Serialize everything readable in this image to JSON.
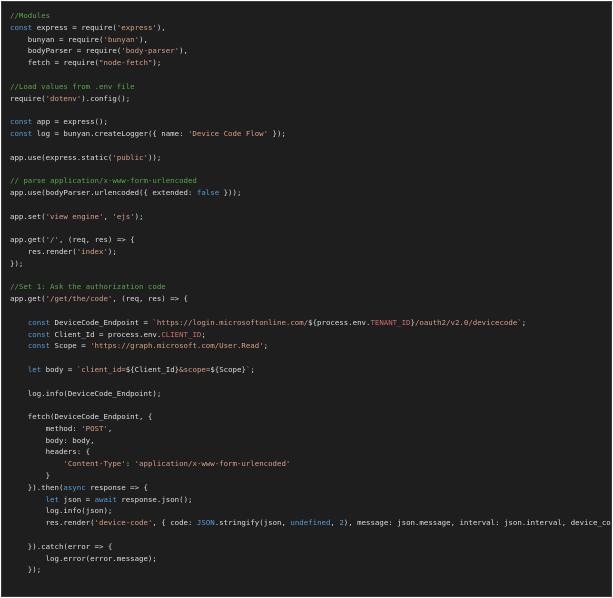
{
  "editor": {
    "lines": [
      [
        {
          "t": "//Modules",
          "k": "comment"
        }
      ],
      [
        {
          "t": "const",
          "k": "keyword"
        },
        {
          "t": " express = require(",
          "k": "plain"
        },
        {
          "t": "'express'",
          "k": "string"
        },
        {
          "t": "),",
          "k": "plain"
        }
      ],
      [
        {
          "t": "    bunyan = require(",
          "k": "plain"
        },
        {
          "t": "'bunyan'",
          "k": "string"
        },
        {
          "t": "),",
          "k": "plain"
        }
      ],
      [
        {
          "t": "    bodyParser = require(",
          "k": "plain"
        },
        {
          "t": "'body-parser'",
          "k": "string"
        },
        {
          "t": "),",
          "k": "plain"
        }
      ],
      [
        {
          "t": "    fetch = require(",
          "k": "plain"
        },
        {
          "t": "\"node-fetch\"",
          "k": "string"
        },
        {
          "t": ");",
          "k": "plain"
        }
      ],
      [],
      [
        {
          "t": "//Load values from .env file",
          "k": "comment"
        }
      ],
      [
        {
          "t": "require(",
          "k": "plain"
        },
        {
          "t": "'dotenv'",
          "k": "string"
        },
        {
          "t": ").config();",
          "k": "plain"
        }
      ],
      [],
      [
        {
          "t": "const",
          "k": "keyword"
        },
        {
          "t": " app = express();",
          "k": "plain"
        }
      ],
      [
        {
          "t": "const",
          "k": "keyword"
        },
        {
          "t": " log = bunyan.createLogger({ name: ",
          "k": "plain"
        },
        {
          "t": "'Device Code Flow'",
          "k": "string"
        },
        {
          "t": " });",
          "k": "plain"
        }
      ],
      [],
      [
        {
          "t": "app.use(express.static(",
          "k": "plain"
        },
        {
          "t": "'public'",
          "k": "string"
        },
        {
          "t": "));",
          "k": "plain"
        }
      ],
      [],
      [
        {
          "t": "// parse application/x-www-form-urlencoded",
          "k": "comment"
        }
      ],
      [
        {
          "t": "app.use(bodyParser.urlencoded({ extended: ",
          "k": "plain"
        },
        {
          "t": "false",
          "k": "keyword"
        },
        {
          "t": " }));",
          "k": "plain"
        }
      ],
      [],
      [
        {
          "t": "app.set(",
          "k": "plain"
        },
        {
          "t": "'view engine'",
          "k": "string"
        },
        {
          "t": ", ",
          "k": "plain"
        },
        {
          "t": "'ejs'",
          "k": "string"
        },
        {
          "t": ");",
          "k": "plain"
        }
      ],
      [],
      [
        {
          "t": "app.get(",
          "k": "plain"
        },
        {
          "t": "'/'",
          "k": "string"
        },
        {
          "t": ", (req, res) => {",
          "k": "plain"
        }
      ],
      [
        {
          "t": "    res.render(",
          "k": "plain"
        },
        {
          "t": "'index'",
          "k": "string"
        },
        {
          "t": ");",
          "k": "plain"
        }
      ],
      [
        {
          "t": "});",
          "k": "plain"
        }
      ],
      [],
      [
        {
          "t": "//Set 1: Ask the authorization code",
          "k": "comment"
        }
      ],
      [
        {
          "t": "app.get(",
          "k": "plain"
        },
        {
          "t": "'/get/the/code'",
          "k": "string"
        },
        {
          "t": ", (req, res) => {",
          "k": "plain"
        }
      ],
      [],
      [
        {
          "t": "    ",
          "k": "plain"
        },
        {
          "t": "const",
          "k": "keyword"
        },
        {
          "t": " DeviceCode_Endpoint = ",
          "k": "plain"
        },
        {
          "t": "`https://login.microsoftonline.com/",
          "k": "string"
        },
        {
          "t": "${process.env.",
          "k": "plain"
        },
        {
          "t": "TENANT_ID",
          "k": "special"
        },
        {
          "t": "}",
          "k": "plain"
        },
        {
          "t": "/oauth2/v2.0/devicecode`",
          "k": "string"
        },
        {
          "t": ";",
          "k": "plain"
        }
      ],
      [
        {
          "t": "    ",
          "k": "plain"
        },
        {
          "t": "const",
          "k": "keyword"
        },
        {
          "t": " Client_Id = process.env.",
          "k": "plain"
        },
        {
          "t": "CLIENT_ID",
          "k": "special"
        },
        {
          "t": ";",
          "k": "plain"
        }
      ],
      [
        {
          "t": "    ",
          "k": "plain"
        },
        {
          "t": "const",
          "k": "keyword"
        },
        {
          "t": " Scope = ",
          "k": "plain"
        },
        {
          "t": "'https://graph.microsoft.com/User.Read'",
          "k": "string"
        },
        {
          "t": ";",
          "k": "plain"
        }
      ],
      [],
      [
        {
          "t": "    ",
          "k": "plain"
        },
        {
          "t": "let",
          "k": "keyword"
        },
        {
          "t": " body = ",
          "k": "plain"
        },
        {
          "t": "`client_id=",
          "k": "string"
        },
        {
          "t": "${Client_Id}",
          "k": "plain"
        },
        {
          "t": "&scope=",
          "k": "string"
        },
        {
          "t": "${Scope}",
          "k": "plain"
        },
        {
          "t": "`",
          "k": "string"
        },
        {
          "t": ";",
          "k": "plain"
        }
      ],
      [],
      [
        {
          "t": "    log.info(DeviceCode_Endpoint);",
          "k": "plain"
        }
      ],
      [],
      [
        {
          "t": "    fetch(DeviceCode_Endpoint, {",
          "k": "plain"
        }
      ],
      [
        {
          "t": "        method: ",
          "k": "plain"
        },
        {
          "t": "'POST'",
          "k": "string"
        },
        {
          "t": ",",
          "k": "plain"
        }
      ],
      [
        {
          "t": "        body: body,",
          "k": "plain"
        }
      ],
      [
        {
          "t": "        headers: {",
          "k": "plain"
        }
      ],
      [
        {
          "t": "            ",
          "k": "plain"
        },
        {
          "t": "'Content-Type'",
          "k": "string"
        },
        {
          "t": ": ",
          "k": "plain"
        },
        {
          "t": "'application/x-www-form-urlencoded'",
          "k": "string"
        }
      ],
      [
        {
          "t": "        }",
          "k": "plain"
        }
      ],
      [
        {
          "t": "    }).then(",
          "k": "plain"
        },
        {
          "t": "async",
          "k": "keyword"
        },
        {
          "t": " response => {",
          "k": "plain"
        }
      ],
      [
        {
          "t": "        ",
          "k": "plain"
        },
        {
          "t": "let",
          "k": "keyword"
        },
        {
          "t": " json = ",
          "k": "plain"
        },
        {
          "t": "await",
          "k": "keyword"
        },
        {
          "t": " response.json();",
          "k": "plain"
        }
      ],
      [
        {
          "t": "        log.info(json);",
          "k": "plain"
        }
      ],
      [
        {
          "t": "        res.render(",
          "k": "plain"
        },
        {
          "t": "'device-code'",
          "k": "string"
        },
        {
          "t": ", { code: ",
          "k": "plain"
        },
        {
          "t": "JSON",
          "k": "keyword"
        },
        {
          "t": ".stringify(json, ",
          "k": "plain"
        },
        {
          "t": "undefined",
          "k": "keyword"
        },
        {
          "t": ", ",
          "k": "plain"
        },
        {
          "t": "2",
          "k": "keyword"
        },
        {
          "t": "), message: json.message, interval: json.interval, device_code: json.device_code });",
          "k": "plain"
        }
      ],
      [],
      [
        {
          "t": "    }).catch(error => {",
          "k": "plain"
        }
      ],
      [
        {
          "t": "        log.error(error.message);",
          "k": "plain"
        }
      ],
      [
        {
          "t": "    });",
          "k": "plain"
        }
      ]
    ]
  }
}
